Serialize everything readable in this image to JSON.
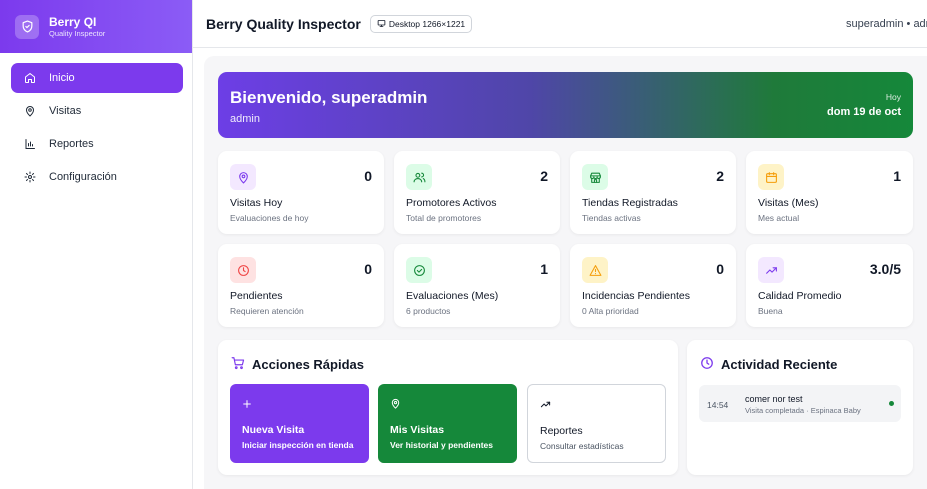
{
  "brand": {
    "title": "Berry QI",
    "subtitle": "Quality Inspector"
  },
  "sidebar": {
    "items": [
      {
        "label": "Inicio",
        "icon": "home-icon",
        "active": true
      },
      {
        "label": "Visitas",
        "icon": "map-pin-icon"
      },
      {
        "label": "Reportes",
        "icon": "bar-chart-icon"
      },
      {
        "label": "Configuración",
        "icon": "gear-icon"
      }
    ]
  },
  "header": {
    "title": "Berry Quality Inspector",
    "device_badge": "Desktop 1266×1221",
    "user": "superadmin • adm"
  },
  "welcome": {
    "title": "Bienvenido, superadmin",
    "role": "admin",
    "today_label": "Hoy",
    "date": "dom 19 de oct"
  },
  "stats": [
    {
      "value": "0",
      "name": "Visitas Hoy",
      "desc": "Evaluaciones de hoy",
      "icon": "map-pin-icon",
      "color": "#7c3aed"
    },
    {
      "value": "2",
      "name": "Promotores Activos",
      "desc": "Total de promotores",
      "icon": "users-icon",
      "color": "#15883a"
    },
    {
      "value": "2",
      "name": "Tiendas Registradas",
      "desc": "Tiendas activas",
      "icon": "store-icon",
      "color": "#15883a"
    },
    {
      "value": "1",
      "name": "Visitas (Mes)",
      "desc": "Mes actual",
      "icon": "calendar-icon",
      "color": "#f59e0b"
    },
    {
      "value": "0",
      "name": "Pendientes",
      "desc": "Requieren atención",
      "icon": "clock-icon",
      "color": "#ef4444"
    },
    {
      "value": "1",
      "name": "Evaluaciones (Mes)",
      "desc": "6 productos",
      "icon": "check-circle-icon",
      "color": "#15883a"
    },
    {
      "value": "0",
      "name": "Incidencias Pendientes",
      "desc": "0 Alta prioridad",
      "icon": "warning-icon",
      "color": "#f59e0b"
    },
    {
      "value": "3.0/5",
      "name": "Calidad Promedio",
      "desc": "Buena",
      "icon": "trending-up-icon",
      "color": "#7c3aed"
    }
  ],
  "quick_actions": {
    "title": "Acciones Rápidas",
    "items": [
      {
        "title": "Nueva Visita",
        "sub": "Iniciar inspección en tienda",
        "icon": "plus-icon",
        "color": "#7c3aed"
      },
      {
        "title": "Mis Visitas",
        "sub": "Ver historial y pendientes",
        "icon": "map-pin-icon",
        "color": "#15883a"
      },
      {
        "title": "Reportes",
        "sub": "Consultar estadísticas",
        "icon": "trending-up-icon",
        "color": "#ffffff"
      }
    ]
  },
  "activity": {
    "title": "Actividad Reciente",
    "items": [
      {
        "time": "14:54",
        "title": "comer nor test",
        "sub": "Visita completada · Espinaca Baby",
        "status_color": "#15883a"
      }
    ]
  }
}
